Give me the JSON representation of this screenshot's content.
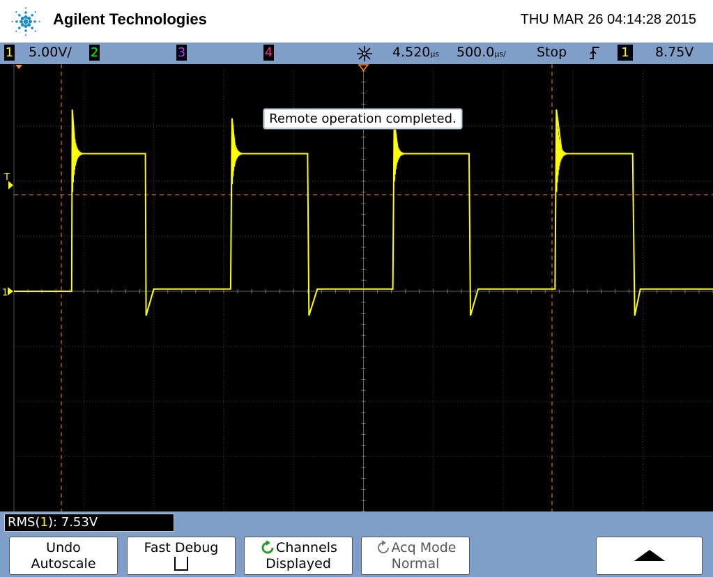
{
  "header": {
    "brand": "Agilent Technologies",
    "datetime": "THU MAR 26 04:14:28 2015",
    "accent_color": "#1a8cc8"
  },
  "status_bar": {
    "ch1_num": "1",
    "ch1_scale": "5.00V/",
    "ch2_num": "2",
    "ch3_num": "3",
    "ch4_num": "4",
    "time_offset": "4.520",
    "time_offset_unit": "µs",
    "timebase": "500.0",
    "timebase_unit": "µs/",
    "run_state": "Stop",
    "trigger_channel": "1",
    "trigger_level": "8.75V",
    "colors": {
      "ch1": "#ffff00",
      "ch2": "#00ff00",
      "ch3": "#b040ff",
      "ch4": "#ff3399"
    }
  },
  "display": {
    "message": "Remote operation completed.",
    "trigger_marker": "T",
    "ground_marker": "1",
    "grid": {
      "cols": 10,
      "rows": 8
    },
    "trace_color": "#ffff00",
    "cursor_color": "#ff8c1a"
  },
  "measurement": {
    "label_prefix": "RMS(",
    "channel": "1",
    "label_suffix": "): 7.53V"
  },
  "softkeys": [
    {
      "line1": "Undo",
      "line2": "Autoscale"
    },
    {
      "line1": "Fast Debug",
      "line2": ""
    },
    {
      "line1": "Channels",
      "line2": "Displayed"
    },
    {
      "line1": "Acq Mode",
      "line2": "Normal"
    }
  ],
  "chart_data": {
    "type": "line",
    "title": "",
    "xlabel": "",
    "ylabel": "",
    "x_unit": "ms",
    "y_unit": "V",
    "xlim": [
      -2.5,
      2.5
    ],
    "ylim": [
      -20,
      20
    ],
    "grid": true,
    "series": [
      {
        "x": [
          -2.5,
          -2.087,
          -2.083,
          -2.06,
          -1.56,
          -1.555,
          -1.5,
          -0.95,
          -0.94,
          -0.915,
          -0.4,
          -0.39,
          -0.33,
          0.21,
          0.22,
          0.25,
          0.755,
          0.765,
          0.82,
          1.37,
          1.38,
          1.42,
          1.925,
          1.94,
          1.98,
          2.5
        ],
        "y": [
          0,
          0,
          16.5,
          12.5,
          12.5,
          -2.2,
          0.2,
          0.2,
          15.7,
          12.5,
          12.5,
          -2.2,
          0.2,
          0.2,
          15.4,
          12.5,
          12.5,
          -2.2,
          0.2,
          0.2,
          16.5,
          12.5,
          12.5,
          -2.2,
          0.2,
          0.2
        ]
      }
    ]
  }
}
